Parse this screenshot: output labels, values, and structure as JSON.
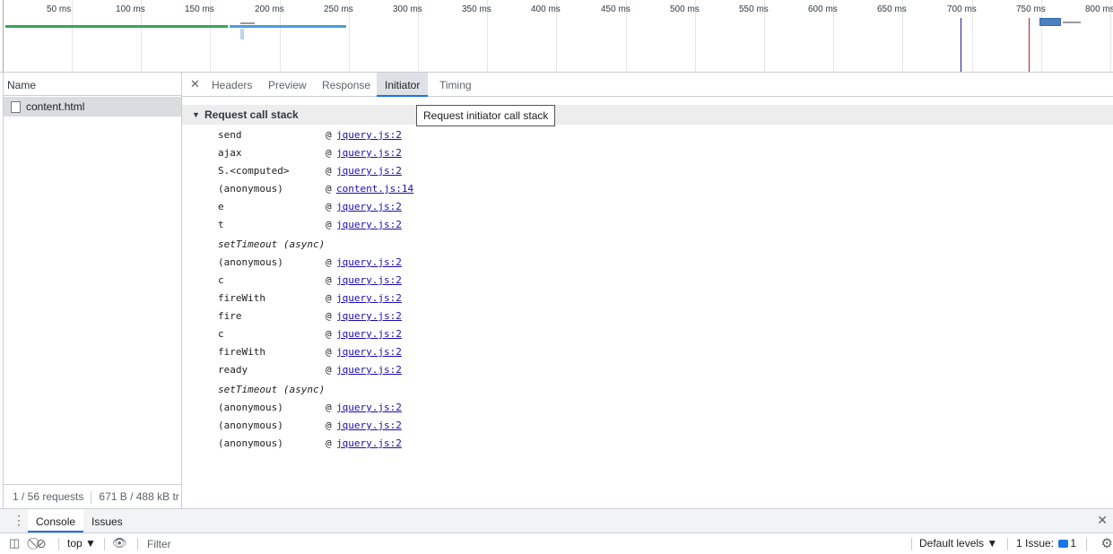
{
  "overview": {
    "ticks": [
      "50 ms",
      "100 ms",
      "150 ms",
      "200 ms",
      "250 ms",
      "300 ms",
      "350 ms",
      "400 ms",
      "450 ms",
      "500 ms",
      "550 ms",
      "600 ms",
      "650 ms",
      "700 ms",
      "750 ms",
      "800 ms"
    ]
  },
  "left_panel": {
    "column_header": "Name",
    "request": "content.html",
    "status_requests": "1 / 56 requests",
    "status_transferred": "671 B / 488 kB tr"
  },
  "tabs": {
    "close_icon": "close-icon",
    "items": [
      "Headers",
      "Preview",
      "Response",
      "Initiator",
      "Timing"
    ],
    "active": "Initiator"
  },
  "initiator": {
    "section_title": "Request call stack",
    "tooltip": "Request initiator call stack",
    "at_symbol": "@",
    "frames": [
      {
        "fn": "send",
        "link": "jquery.js:2"
      },
      {
        "fn": "ajax",
        "link": "jquery.js:2"
      },
      {
        "fn": "S.<computed>",
        "link": "jquery.js:2"
      },
      {
        "fn": "(anonymous)",
        "link": "content.js:14"
      },
      {
        "fn": "e",
        "link": "jquery.js:2"
      },
      {
        "fn": "t",
        "link": "jquery.js:2"
      },
      {
        "async": "setTimeout (async)"
      },
      {
        "fn": "(anonymous)",
        "link": "jquery.js:2"
      },
      {
        "fn": "c",
        "link": "jquery.js:2"
      },
      {
        "fn": "fireWith",
        "link": "jquery.js:2"
      },
      {
        "fn": "fire",
        "link": "jquery.js:2"
      },
      {
        "fn": "c",
        "link": "jquery.js:2"
      },
      {
        "fn": "fireWith",
        "link": "jquery.js:2"
      },
      {
        "fn": "ready",
        "link": "jquery.js:2"
      },
      {
        "async": "setTimeout (async)"
      },
      {
        "fn": "(anonymous)",
        "link": "jquery.js:2"
      },
      {
        "fn": "(anonymous)",
        "link": "jquery.js:2"
      },
      {
        "fn": "(anonymous)",
        "link": "jquery.js:2"
      }
    ]
  },
  "drawer": {
    "tabs": [
      "Console",
      "Issues"
    ],
    "active": "Console",
    "context": "top ▼",
    "filter_placeholder": "Filter",
    "levels": "Default levels ▼",
    "issues_label": "1 Issue:",
    "issues_count": "1"
  },
  "colors": {
    "accent": "#1a73e8",
    "link": "#1a0dab",
    "green_segment": "#34a853",
    "blue_segment": "#4a9ee0",
    "dom_content_line": "#1f1f8a",
    "load_line": "#a2292d"
  }
}
